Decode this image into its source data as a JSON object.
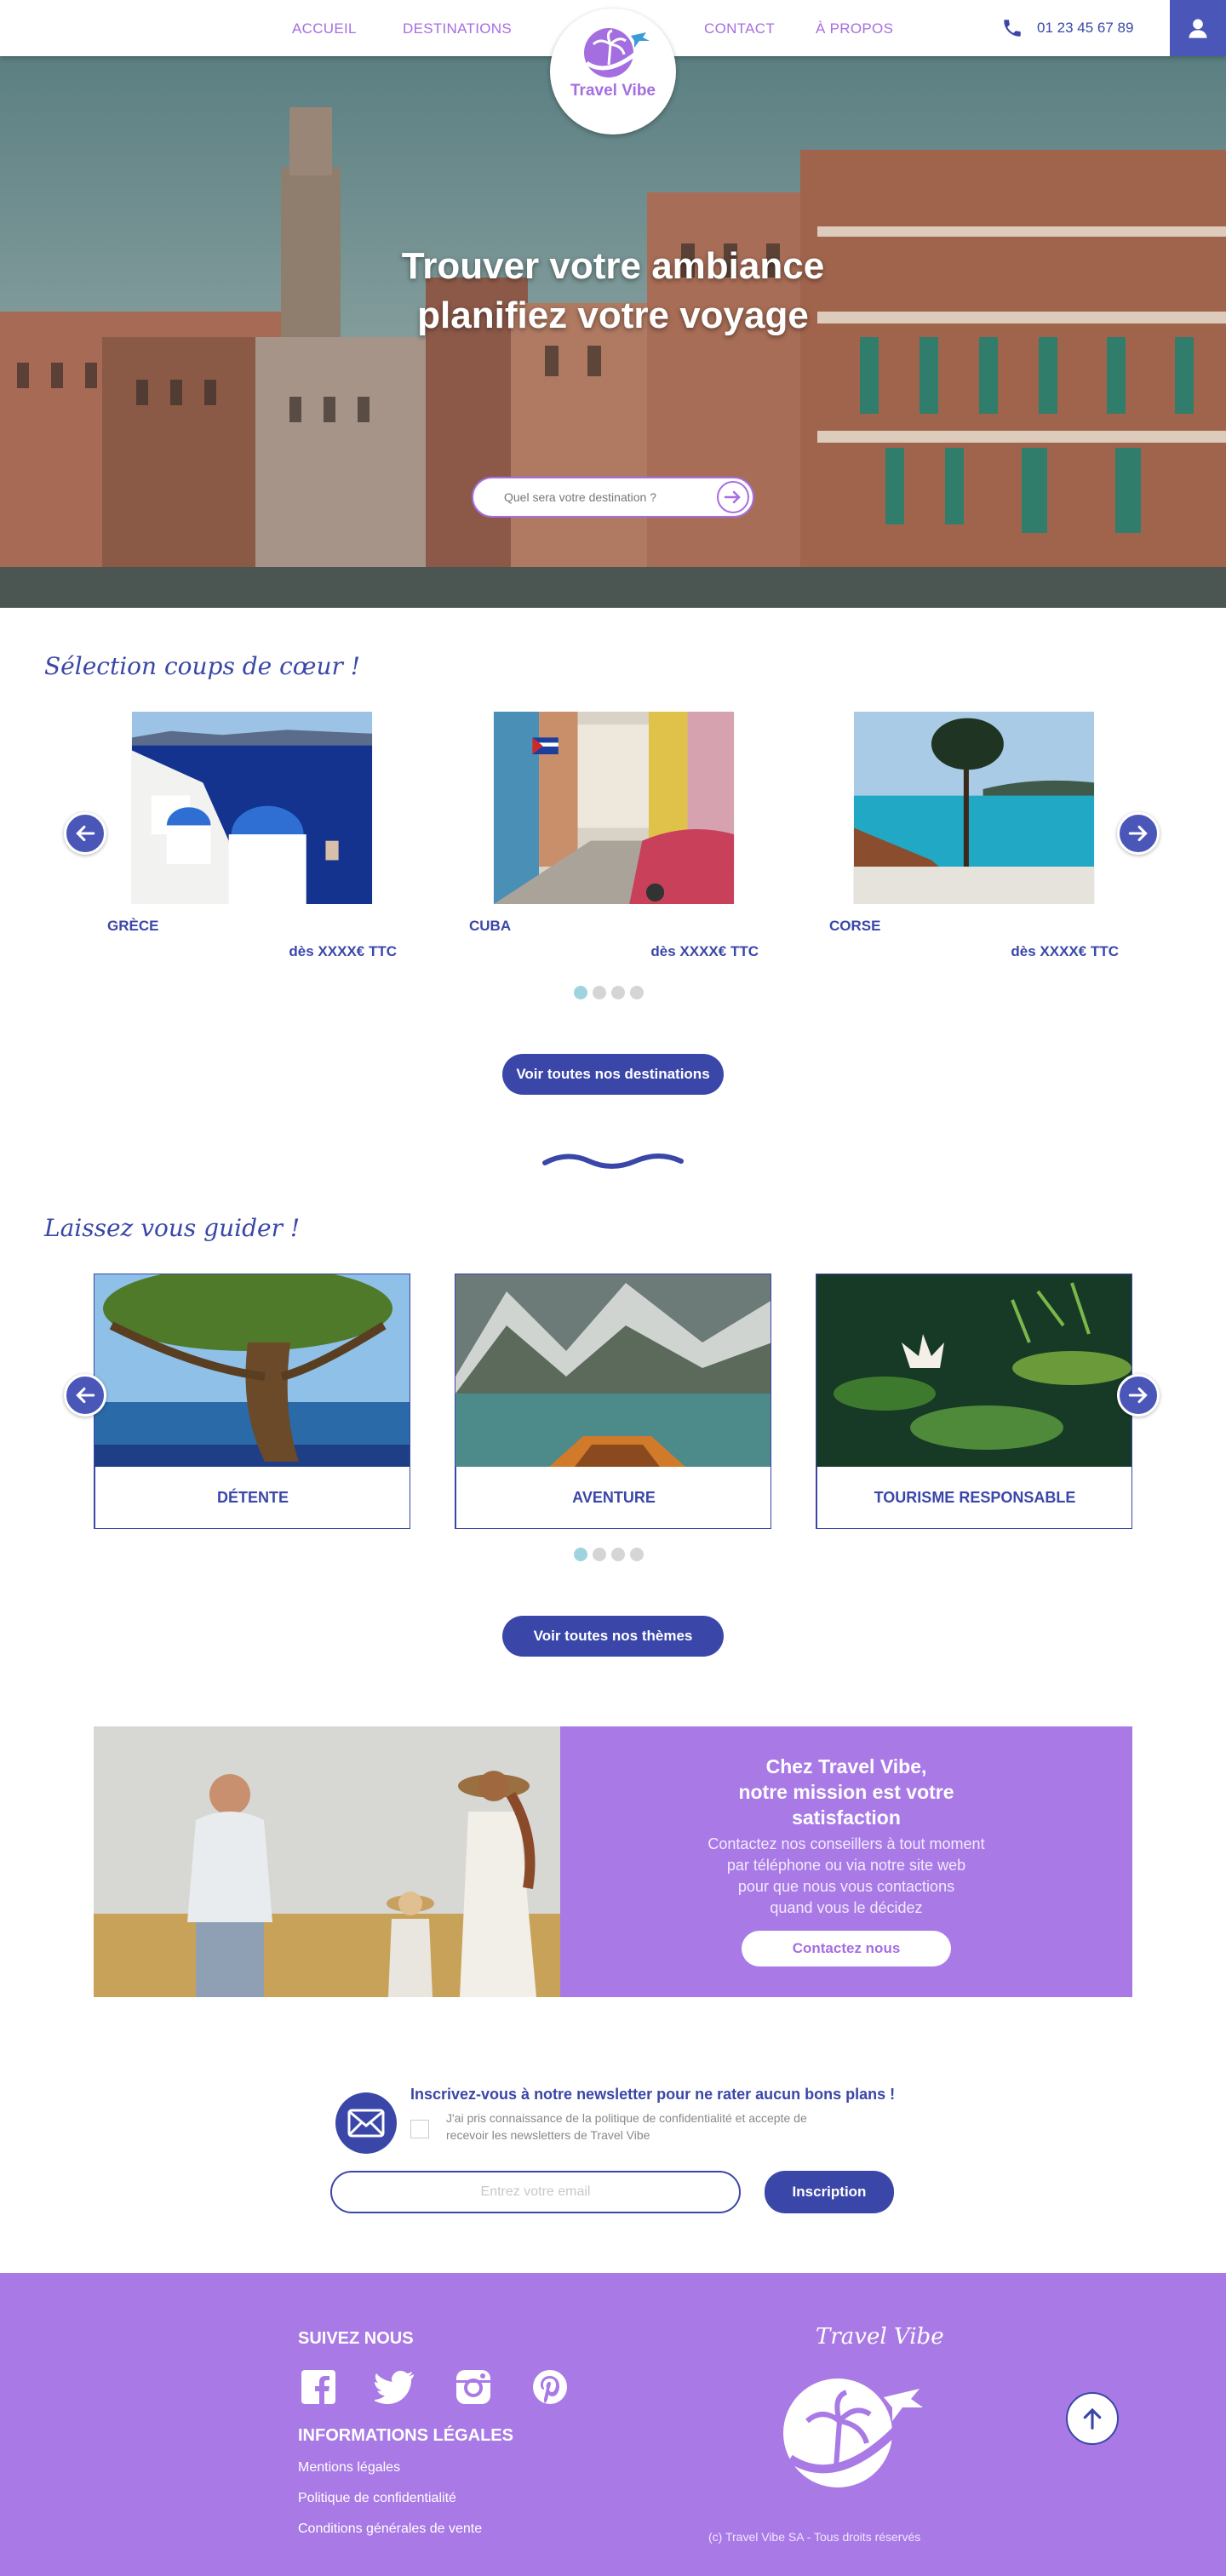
{
  "header": {
    "nav_left": [
      "ACCUEIL",
      "DESTINATIONS"
    ],
    "nav_right": [
      "CONTACT",
      "À PROPOS"
    ],
    "logo_text": "Travel Vibe",
    "phone": "01 23 45 67 89",
    "icons": {
      "phone": "phone-icon",
      "user": "user-icon",
      "logo": "palm-globe-plane-logo"
    }
  },
  "hero": {
    "title_line1": "Trouver votre ambiance",
    "title_line2": "planifiez votre voyage",
    "search_placeholder": "Quel sera votre destination ?"
  },
  "favorites": {
    "title": "Sélection coups de cœur !",
    "cards": [
      {
        "name": "GRÈCE",
        "price": "dès XXXX€ TTC"
      },
      {
        "name": "CUBA",
        "price": "dès XXXX€ TTC"
      },
      {
        "name": "CORSE",
        "price": "dès XXXX€ TTC"
      }
    ],
    "dots": 4,
    "active_dot": 1,
    "button": "Voir toutes nos destinations"
  },
  "themes": {
    "title": "Laissez vous guider !",
    "cards": [
      {
        "name": "DÉTENTE"
      },
      {
        "name": "AVENTURE"
      },
      {
        "name": "TOURISME RESPONSABLE"
      }
    ],
    "dots": 4,
    "active_dot": 1,
    "button": "Voir toutes nos thèmes"
  },
  "mission": {
    "title_lines": [
      "Chez Travel Vibe,",
      "notre mission est votre",
      "satisfaction"
    ],
    "text_lines": [
      "Contactez nos conseillers à tout moment",
      "par téléphone ou via notre site web",
      "pour que nous vous contactions",
      "quand vous le décidez"
    ],
    "button": "Contactez nous"
  },
  "newsletter": {
    "title": "Inscrivez-vous à notre newsletter pour ne rater aucun bons plans !",
    "consent_line1": "J'ai pris connaissance de la politique de confidentialité et accepte de",
    "consent_line2": "recevoir les newsletters de Travel Vibe",
    "email_placeholder": "Entrez votre email",
    "button": "Inscription"
  },
  "footer": {
    "follow_heading": "SUIVEZ NOUS",
    "social_icons": [
      "facebook-icon",
      "twitter-icon",
      "instagram-icon",
      "pinterest-icon"
    ],
    "legal_heading": "INFORMATIONS LÉGALES",
    "legal_links": [
      "Mentions légales",
      "Politique de confidentialité",
      "Conditions générales de vente"
    ],
    "brand": "Travel Vibe",
    "copyright": "(c) Travel Vibe SA - Tous droits réservés"
  },
  "colors": {
    "primary": "#3a47a8",
    "accent_purple": "#a97ae6",
    "link_purple": "#a56ee0",
    "active_dot": "#9fd3e0"
  }
}
